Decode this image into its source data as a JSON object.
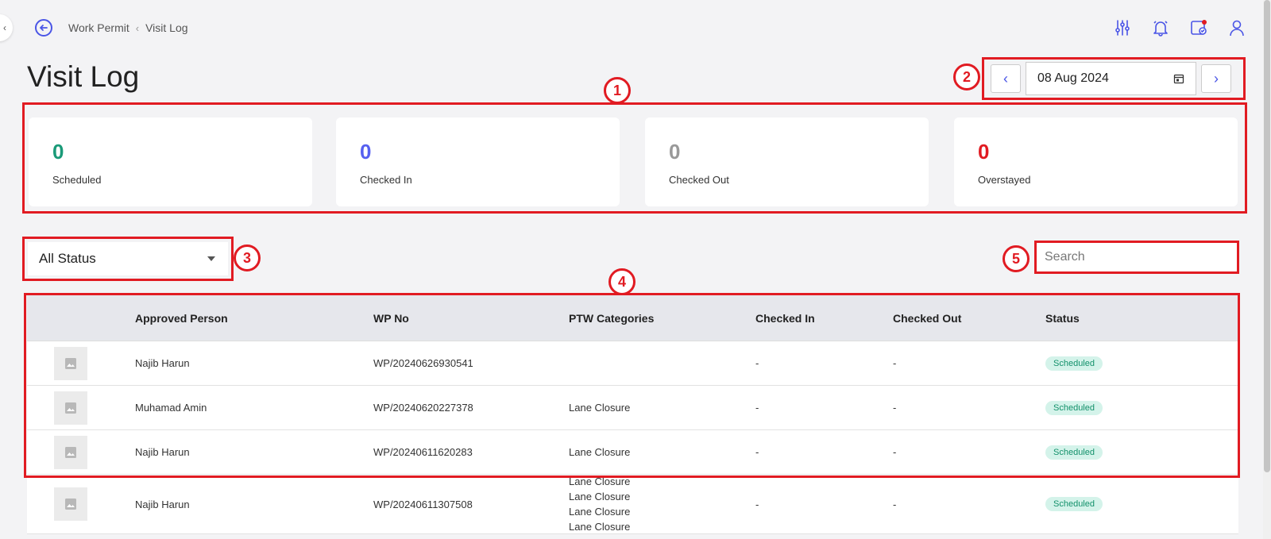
{
  "breadcrumb": {
    "parent": "Work Permit",
    "current": "Visit Log"
  },
  "page_title": "Visit Log",
  "date_nav": {
    "date": "08 Aug 2024"
  },
  "stats": [
    {
      "value": "0",
      "label": "Scheduled",
      "color": "#1a9a78"
    },
    {
      "value": "0",
      "label": "Checked In",
      "color": "#5660f0"
    },
    {
      "value": "0",
      "label": "Checked Out",
      "color": "#999999"
    },
    {
      "value": "0",
      "label": "Overstayed",
      "color": "#e11b22"
    }
  ],
  "filter": {
    "status_selected": "All Status"
  },
  "search": {
    "placeholder": "Search"
  },
  "table": {
    "headers": [
      "Approved Person",
      "WP No",
      "PTW Categories",
      "Checked In",
      "Checked Out",
      "Status"
    ],
    "rows": [
      {
        "person": "Najib Harun",
        "wp_no": "WP/20240626930541",
        "categories": [],
        "checked_in": "-",
        "checked_out": "-",
        "status": "Scheduled"
      },
      {
        "person": "Muhamad Amin",
        "wp_no": "WP/20240620227378",
        "categories": [
          "Lane Closure"
        ],
        "checked_in": "-",
        "checked_out": "-",
        "status": "Scheduled"
      },
      {
        "person": "Najib Harun",
        "wp_no": "WP/20240611620283",
        "categories": [
          "Lane Closure"
        ],
        "checked_in": "-",
        "checked_out": "-",
        "status": "Scheduled"
      },
      {
        "person": "Najib Harun",
        "wp_no": "WP/20240611307508",
        "categories": [
          "Lane Closure",
          "Lane Closure",
          "Lane Closure",
          "Lane Closure"
        ],
        "checked_in": "-",
        "checked_out": "-",
        "status": "Scheduled"
      }
    ]
  },
  "callouts": [
    "1",
    "2",
    "3",
    "4",
    "5"
  ],
  "icons": [
    "back-arrow-icon",
    "filter-sliders-icon",
    "bell-icon",
    "calendar-check-icon",
    "user-icon",
    "chevron-left-icon",
    "chevron-right-icon",
    "calendar-icon",
    "caret-down-icon",
    "image-placeholder-icon"
  ],
  "colors": {
    "accent": "#4a55e6",
    "annotation": "#e11b22",
    "badge_bg": "#d4f3ea",
    "badge_text": "#13916b"
  }
}
